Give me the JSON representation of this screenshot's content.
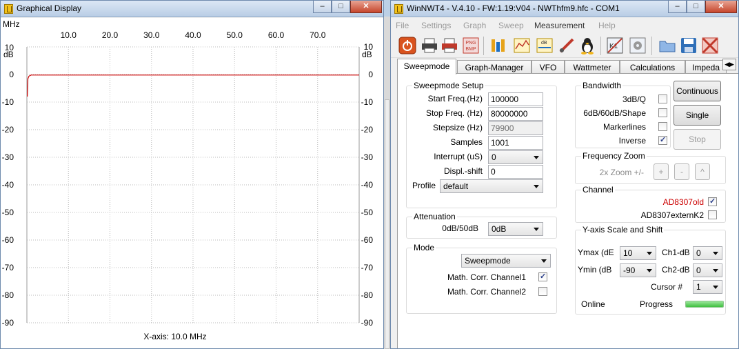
{
  "graph_window": {
    "title": "Graphical Display",
    "x_unit": "MHz",
    "y_unit": "dB",
    "x_ticks": [
      "10.0",
      "20.0",
      "30.0",
      "40.0",
      "50.0",
      "60.0",
      "70.0"
    ],
    "y_ticks": [
      "10",
      "0",
      "-10",
      "-20",
      "-30",
      "-40",
      "-50",
      "-60",
      "-70",
      "-80",
      "-90"
    ],
    "x_axis_label": "X-axis: 10.0 MHz",
    "trace_color": "#cc0000",
    "chart_data": {
      "type": "line",
      "x_unit": "MHz",
      "y_unit": "dB",
      "xlim": [
        0.1,
        80.0
      ],
      "ylim": [
        -90,
        10
      ],
      "grid": true,
      "series": [
        {
          "x": [
            0.1,
            0.25,
            0.5,
            1,
            2,
            5,
            10,
            20,
            30,
            40,
            50,
            60,
            70,
            80
          ],
          "y": [
            -8,
            -1.5,
            -0.6,
            -0.2,
            -0.2,
            -0.2,
            -0.2,
            -0.2,
            -0.2,
            -0.2,
            -0.2,
            -0.2,
            -0.2,
            -0.2
          ]
        }
      ]
    }
  },
  "main_window": {
    "title": "WinNWT4 - V.4.10 - FW:1.19:V04 - NWThfm9.hfc - COM1",
    "menu": [
      "File",
      "Settings",
      "Graph",
      "Sweep",
      "Measurement",
      "Help"
    ],
    "tabs": [
      "Sweepmode",
      "Graph-Manager",
      "VFO",
      "Wattmeter",
      "Calculations",
      "Impeda"
    ],
    "toolbar_icons": [
      "power-icon",
      "printer-icon",
      "printer-color-icon",
      "png-bmp-icon",
      "calibration-icon",
      "chart-icon",
      "db-icon",
      "probe-icon",
      "linux-penguin-icon",
      "k1-icon",
      "settings-icon",
      "open-folder-icon",
      "save-icon",
      "close-grid-icon"
    ],
    "sweepmode_setup": {
      "title": "Sweepmode Setup",
      "start_label": "Start Freq.(Hz)",
      "start_value": "100000",
      "stop_label": "Stop Freq. (Hz)",
      "stop_value": "80000000",
      "step_label": "Stepsize (Hz)",
      "step_value": "79900",
      "samples_label": "Samples",
      "samples_value": "1001",
      "interrupt_label": "Interrupt (uS)",
      "interrupt_value": "0",
      "shift_label": "Displ.-shift",
      "shift_value": "0",
      "profile_label": "Profile",
      "profile_value": "default"
    },
    "attenuation": {
      "title": "Attenuation",
      "label": "0dB/50dB",
      "value": "0dB"
    },
    "mode": {
      "title": "Mode",
      "value": "Sweepmode",
      "corr1_label": "Math. Corr. Channel1",
      "corr1_checked": true,
      "corr2_label": "Math. Corr. Channel2",
      "corr2_checked": false
    },
    "bandwidth": {
      "title": "Bandwidth",
      "bw3_label": "3dB/Q",
      "bw3_checked": false,
      "bw60_label": "6dB/60dB/Shape",
      "bw60_checked": false,
      "marker_label": "Markerlines",
      "marker_checked": false,
      "inverse_label": "Inverse",
      "inverse_checked": true
    },
    "buttons": {
      "continuous": "Continuous",
      "single": "Single",
      "stop": "Stop"
    },
    "freq_zoom": {
      "title": "Frequency Zoom",
      "label": "2x Zoom +/-",
      "plus": "+",
      "minus": "-",
      "up": "^"
    },
    "channel": {
      "title": "Channel",
      "ch1_label": "AD8307old",
      "ch1_checked": true,
      "ch1_color": "#cc0000",
      "ch2_label": "AD8307externK2",
      "ch2_checked": false
    },
    "yaxis": {
      "title": "Y-axis Scale and Shift",
      "ymax_label": "Ymax (dE",
      "ymax_value": "10",
      "ymin_label": "Ymin (dB",
      "ymin_value": "-90",
      "ch1db_label": "Ch1-dB",
      "ch1db_value": "0",
      "ch2db_label": "Ch2-dB",
      "ch2db_value": "0",
      "cursor_label": "Cursor #",
      "cursor_value": "1",
      "online_label": "Online",
      "progress_label": "Progress",
      "progress_fraction": 1.0
    }
  }
}
